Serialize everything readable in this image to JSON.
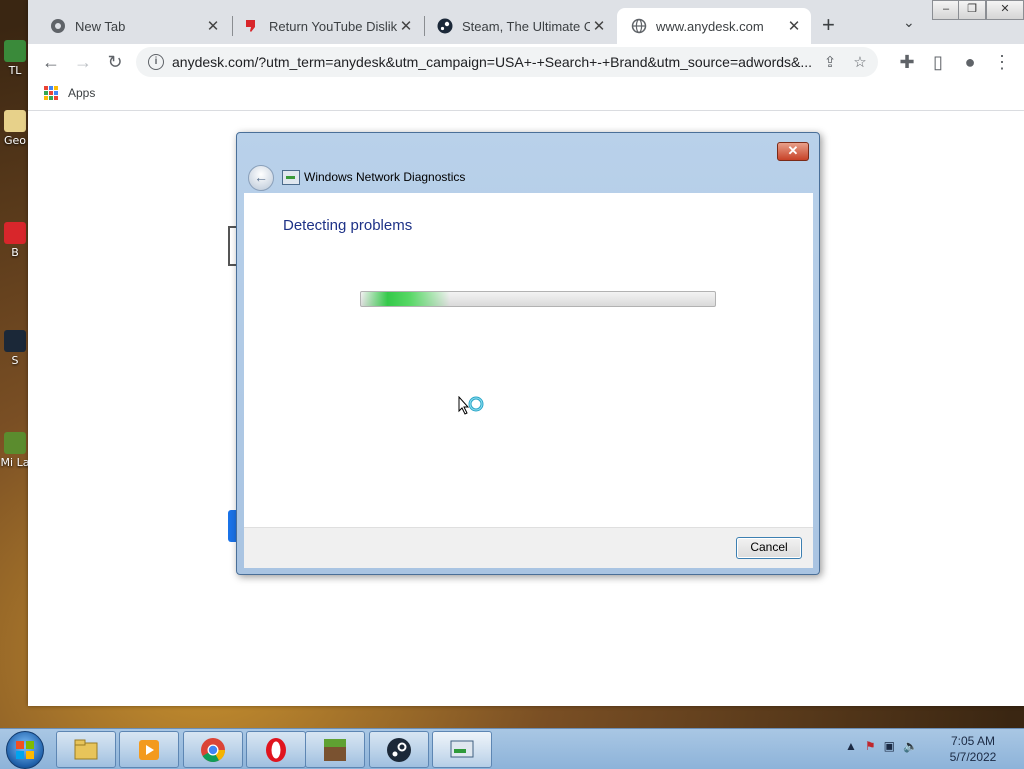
{
  "browser": {
    "tabs": [
      {
        "title": "New Tab",
        "icon": "chrome-icon"
      },
      {
        "title": "Return YouTube Dislike",
        "icon": "dislike-icon"
      },
      {
        "title": "Steam, The Ultimate Onl",
        "icon": "steam-icon"
      },
      {
        "title": "www.anydesk.com",
        "icon": "globe-icon",
        "active": true
      }
    ],
    "new_tab_symbol": "+",
    "url": "anydesk.com/?utm_term=anydesk&utm_campaign=USA+-+Search+-+Brand&utm_source=adwords&...",
    "bookmarks": [
      {
        "label": "Apps"
      }
    ]
  },
  "desktop_icons": [
    "TL",
    "Geo",
    "B",
    "S",
    "Mi La"
  ],
  "dialog": {
    "title": "Windows Network Diagnostics",
    "heading": "Detecting problems",
    "progress_fraction": 0.25,
    "cancel_label": "Cancel",
    "close_symbol": "✕"
  },
  "taskbar": {
    "apps": [
      "file-explorer-icon",
      "media-player-icon",
      "chrome-icon",
      "opera-icon",
      "minecraft-icon",
      "steam-icon",
      "network-diagnostics-icon"
    ],
    "time": "7:05 AM",
    "date": "5/7/2022"
  }
}
